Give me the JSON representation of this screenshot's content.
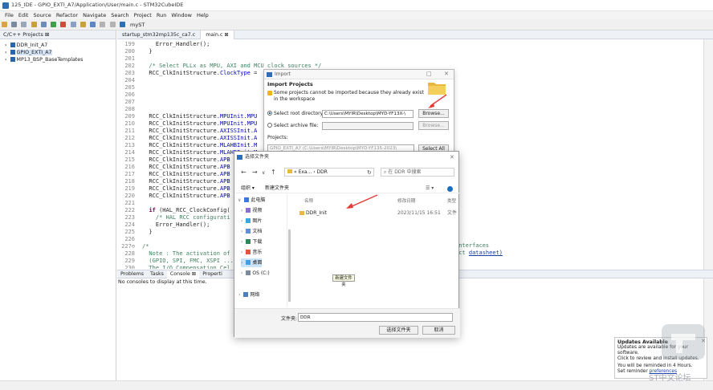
{
  "window": {
    "title": "125_IDE - GPIO_EXTI_A7/Application/User/main.c - STM32CubeIDE"
  },
  "menu": [
    "File",
    "Edit",
    "Source",
    "Refactor",
    "Navigate",
    "Search",
    "Project",
    "Run",
    "Window",
    "Help"
  ],
  "toolbar": {
    "perspective_label": "myST"
  },
  "left_panel": {
    "tab_label": "C/C++ Projects ⊠",
    "projects": [
      "DDR_Init_A7",
      "GPIO_EXTI_A7",
      "MP13_BSP_BaseTemplates"
    ]
  },
  "editor": {
    "tabs": [
      "startup_stm32mp135c_ca7.c",
      "main.c ⊠"
    ],
    "lines": [
      {
        "n": "199",
        "segs": [
          {
            "t": "    Error_Handler();"
          }
        ]
      },
      {
        "n": "200",
        "segs": [
          {
            "t": "  }"
          }
        ]
      },
      {
        "n": "201",
        "segs": [
          {
            "t": ""
          }
        ]
      },
      {
        "n": "202",
        "segs": [
          {
            "t": "  /* Select PLLx as MPU, AXI and MCU clock sources */",
            "c": "cm"
          }
        ]
      },
      {
        "n": "203",
        "segs": [
          {
            "t": "  RCC_ClkInitStructure."
          },
          {
            "t": "ClockType",
            "c": "fld"
          },
          {
            "t": " ="
          }
        ]
      },
      {
        "n": "204",
        "segs": [
          {
            "t": ""
          }
        ]
      },
      {
        "n": "205",
        "segs": [
          {
            "t": ""
          }
        ]
      },
      {
        "n": "206",
        "segs": [
          {
            "t": ""
          }
        ]
      },
      {
        "n": "207",
        "segs": [
          {
            "t": ""
          }
        ]
      },
      {
        "n": "208",
        "segs": [
          {
            "t": ""
          }
        ]
      },
      {
        "n": "209",
        "segs": [
          {
            "t": "  RCC_ClkInitStructure."
          },
          {
            "t": "MPUInit.MPU",
            "c": "fld"
          }
        ]
      },
      {
        "n": "210",
        "segs": [
          {
            "t": "  RCC_ClkInitStructure."
          },
          {
            "t": "MPUInit.MPU",
            "c": "fld"
          }
        ]
      },
      {
        "n": "211",
        "segs": [
          {
            "t": "  RCC_ClkInitStructure."
          },
          {
            "t": "AXISSInit.A",
            "c": "fld"
          }
        ]
      },
      {
        "n": "212",
        "segs": [
          {
            "t": "  RCC_ClkInitStructure."
          },
          {
            "t": "AXISSInit.A",
            "c": "fld"
          }
        ]
      },
      {
        "n": "213",
        "segs": [
          {
            "t": "  RCC_ClkInitStructure."
          },
          {
            "t": "MLAHBInit.M",
            "c": "fld"
          }
        ]
      },
      {
        "n": "214",
        "segs": [
          {
            "t": "  RCC_ClkInitStructure."
          },
          {
            "t": "MLAHBInit.M",
            "c": "fld"
          }
        ]
      },
      {
        "n": "215",
        "segs": [
          {
            "t": "  RCC_ClkInitStructure."
          },
          {
            "t": "APB",
            "c": "fld"
          }
        ]
      },
      {
        "n": "216",
        "segs": [
          {
            "t": "  RCC_ClkInitStructure."
          },
          {
            "t": "APB",
            "c": "fld"
          }
        ]
      },
      {
        "n": "217",
        "segs": [
          {
            "t": "  RCC_ClkInitStructure."
          },
          {
            "t": "APB",
            "c": "fld"
          }
        ]
      },
      {
        "n": "218",
        "segs": [
          {
            "t": "  RCC_ClkInitStructure."
          },
          {
            "t": "APB",
            "c": "fld"
          }
        ]
      },
      {
        "n": "219",
        "segs": [
          {
            "t": "  RCC_ClkInitStructure."
          },
          {
            "t": "APB",
            "c": "fld"
          }
        ]
      },
      {
        "n": "220",
        "segs": [
          {
            "t": "  RCC_ClkInitStructure."
          },
          {
            "t": "APB",
            "c": "fld"
          }
        ]
      },
      {
        "n": "221",
        "segs": [
          {
            "t": ""
          }
        ]
      },
      {
        "n": "222",
        "segs": [
          {
            "t": "  "
          },
          {
            "t": "if",
            "c": "kw"
          },
          {
            "t": " (HAL_RCC_ClockConfig("
          }
        ]
      },
      {
        "n": "223",
        "segs": [
          {
            "t": "    /* HAL RCC configurati",
            "c": "cm"
          }
        ]
      },
      {
        "n": "224",
        "segs": [
          {
            "t": "    Error_Handler();"
          }
        ]
      },
      {
        "n": "225",
        "segs": [
          {
            "t": "  }"
          }
        ]
      },
      {
        "n": "226",
        "segs": [
          {
            "t": ""
          }
        ]
      },
      {
        "n": "227⊖",
        "segs": [
          {
            "t": "/*",
            "c": "cm"
          }
        ]
      },
      {
        "n": "228",
        "segs": [
          {
            "t": "  Note : The activation of",
            "c": "cm"
          }
        ]
      },
      {
        "n": "229",
        "segs": [
          {
            "t": "  (GPIO, SPI, FMC, XSPI ...",
            "c": "cm"
          }
        ]
      },
      {
        "n": "230",
        "segs": [
          {
            "t": "  The I/O Compensation Cel",
            "c": "cm"
          }
        ]
      }
    ],
    "right_fragments": {
      "line228": "interfaces",
      "line229_pre": "uct ",
      "line229_link": "datasheet)"
    }
  },
  "bottom_panel": {
    "tabs": [
      "Problems",
      "Tasks",
      "Console ⊠",
      "Properti"
    ],
    "console_text": "No consoles to display at this time."
  },
  "import_dialog": {
    "window_title": "Import",
    "title": "Import Projects",
    "message": "Some projects cannot be imported because they already exist in the workspace",
    "root_dir_label": "Select root directory:",
    "root_dir_value": "C:\\Users\\MYIR\\Desktop\\MYD-YF13X-\\",
    "archive_label": "Select archive file:",
    "browse1": "Browse...",
    "browse2": "Browse...",
    "projects_label": "Projects:",
    "project_row": "GPIO_EXTI_A7 (C:\\Users\\MYIR\\Desktop\\MYD-YF135-2023\\",
    "select_all": "Select All"
  },
  "folder_picker": {
    "title": "选择文件夹",
    "breadcrumb": [
      "Exa...",
      "DDR"
    ],
    "search_placeholder": "在 DDR 中搜索",
    "organize": "组织 ▾",
    "new_folder": "新建文件夹",
    "sidebar": [
      {
        "label": "此电脑",
        "color": "#3b78d8"
      },
      {
        "label": "视频",
        "color": "#8a6fd1"
      },
      {
        "label": "图片",
        "color": "#3ba6e3"
      },
      {
        "label": "文档",
        "color": "#5b8fd8"
      },
      {
        "label": "下载",
        "color": "#2a8a5a"
      },
      {
        "label": "音乐",
        "color": "#e0553c"
      },
      {
        "label": "桌面",
        "color": "#3fa0e8"
      },
      {
        "label": "OS (C:)",
        "color": "#7a8ba0"
      },
      {
        "label": "网络",
        "color": "#4a7fc0"
      }
    ],
    "columns": [
      "名称",
      "修改日期",
      "类型"
    ],
    "rows": [
      {
        "name": "DDR_Init",
        "date": "2023/11/15 16:51",
        "type": "文件"
      }
    ],
    "folder_label": "文件夹:",
    "folder_value": "DDR",
    "select_btn": "选择文件夹",
    "cancel_btn": "取消",
    "tooltip": "新建文件夹"
  },
  "updates": {
    "title": "Updates Available",
    "line1": "Updates are available for your software.",
    "line2": "Click to review and install updates.",
    "line3": "You will be reminded in 4 Hours.",
    "line4_pre": "Set reminder ",
    "line4_link": "preferences"
  },
  "watermark": {
    "text": "ST中文论坛"
  },
  "colors": {
    "accent": "#2d6fb5",
    "arrow": "#e53935",
    "comment": "#3f7f5f",
    "keyword": "#7f0055",
    "field": "#0000c0"
  }
}
